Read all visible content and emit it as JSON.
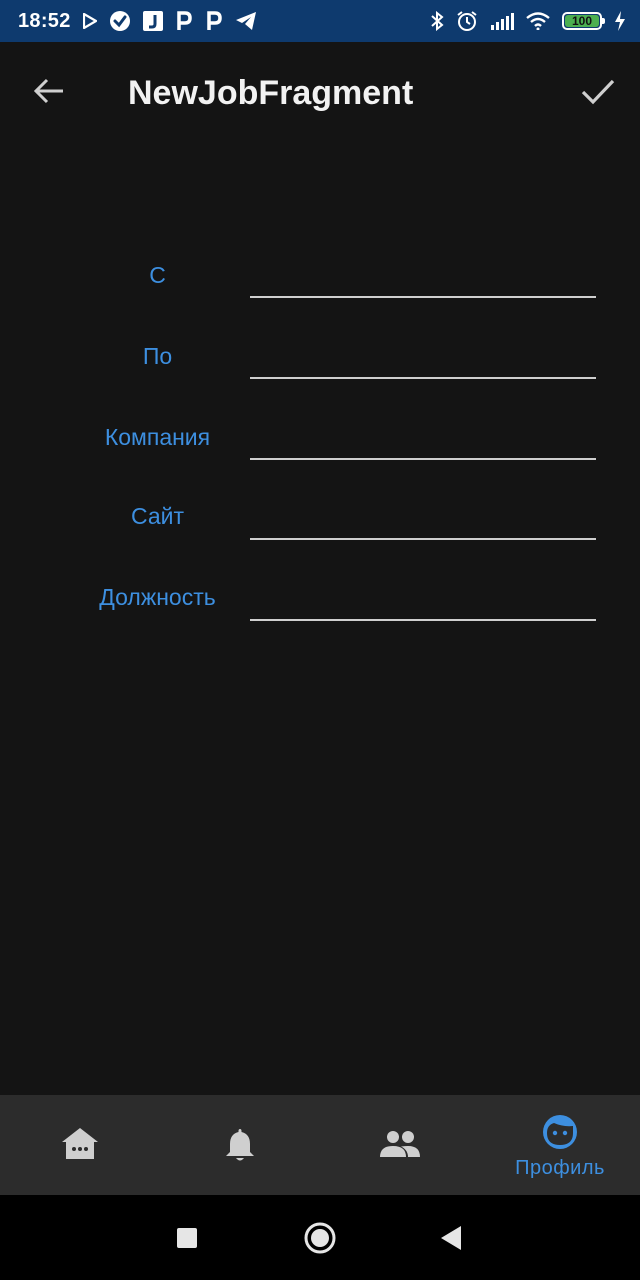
{
  "status_bar": {
    "time": "18:52",
    "battery": "100",
    "left_icons": [
      "play-store-icon",
      "check-circle-icon",
      "j-app-icon",
      "p-app-icon",
      "p-app-icon",
      "telegram-icon"
    ],
    "right_icons": [
      "bluetooth-icon",
      "alarm-icon",
      "signal-icon",
      "wifi-icon",
      "battery-icon",
      "charging-icon"
    ]
  },
  "toolbar": {
    "title": "NewJobFragment",
    "back_icon": "arrow-back-icon",
    "done_icon": "check-icon"
  },
  "form": {
    "fields": [
      {
        "label": "С",
        "value": ""
      },
      {
        "label": "По",
        "value": ""
      },
      {
        "label": "Компания",
        "value": ""
      },
      {
        "label": "Сайт",
        "value": ""
      },
      {
        "label": "Должность",
        "value": ""
      }
    ]
  },
  "bottom_nav": {
    "items": [
      {
        "icon": "home-icon",
        "label": ""
      },
      {
        "icon": "bell-icon",
        "label": ""
      },
      {
        "icon": "people-icon",
        "label": ""
      },
      {
        "icon": "face-icon",
        "label": "Профиль",
        "active": true
      }
    ]
  },
  "colors": {
    "status_bar": "#0e3a6e",
    "background": "#141414",
    "accent": "#3d8fe0",
    "nav_bg": "#2c2c2c",
    "icon_inactive": "#cfcfcf"
  }
}
